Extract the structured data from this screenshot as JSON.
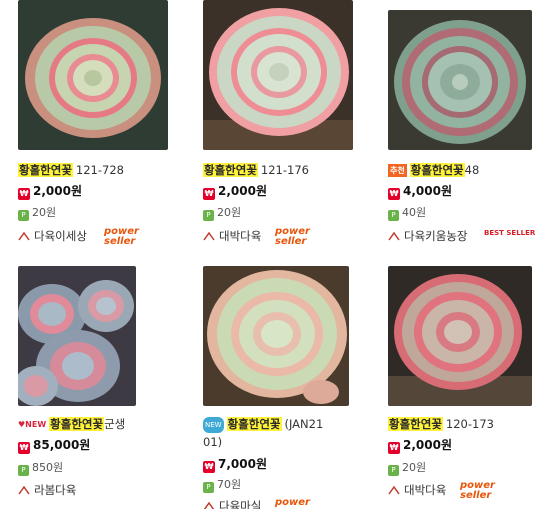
{
  "products": [
    {
      "name": "황홀한연꽃",
      "code": "121-728",
      "price": "2,000원",
      "points": "20원",
      "seller": "다육이세상",
      "badge": "power seller",
      "tag": ""
    },
    {
      "name": "황홀한연꽃",
      "code": "121-176",
      "price": "2,000원",
      "points": "20원",
      "seller": "대박다육",
      "badge": "power seller",
      "tag": ""
    },
    {
      "name": "황홀한연꽃",
      "code": "48",
      "price": "4,000원",
      "points": "40원",
      "seller": "다육키움농장",
      "badge": "BEST SELLER",
      "tag": "추천"
    },
    {
      "name": "황홀한연꽃",
      "code": "군생",
      "price": "85,000원",
      "points": "850원",
      "seller": "라봄다육",
      "badge": "",
      "tag": "NEW"
    },
    {
      "name": "황홀한연꽃",
      "code": "(JAN21",
      "code2": "01)",
      "price": "7,000원",
      "points": "70원",
      "seller": "다육마실",
      "badge": "power",
      "tag": "NEW"
    },
    {
      "name": "황홀한연꽃",
      "code": "120-173",
      "price": "2,000원",
      "points": "20원",
      "seller": "대박다육",
      "badge": "power seller",
      "tag": ""
    }
  ],
  "icons": {
    "price": "price-icon",
    "points": "points-icon",
    "seller": "home-icon"
  },
  "colors": {
    "highlight": "#fff23a",
    "price_icon": "#e4002b",
    "points_icon": "#6ab24a",
    "power_seller": "#e8560c"
  }
}
